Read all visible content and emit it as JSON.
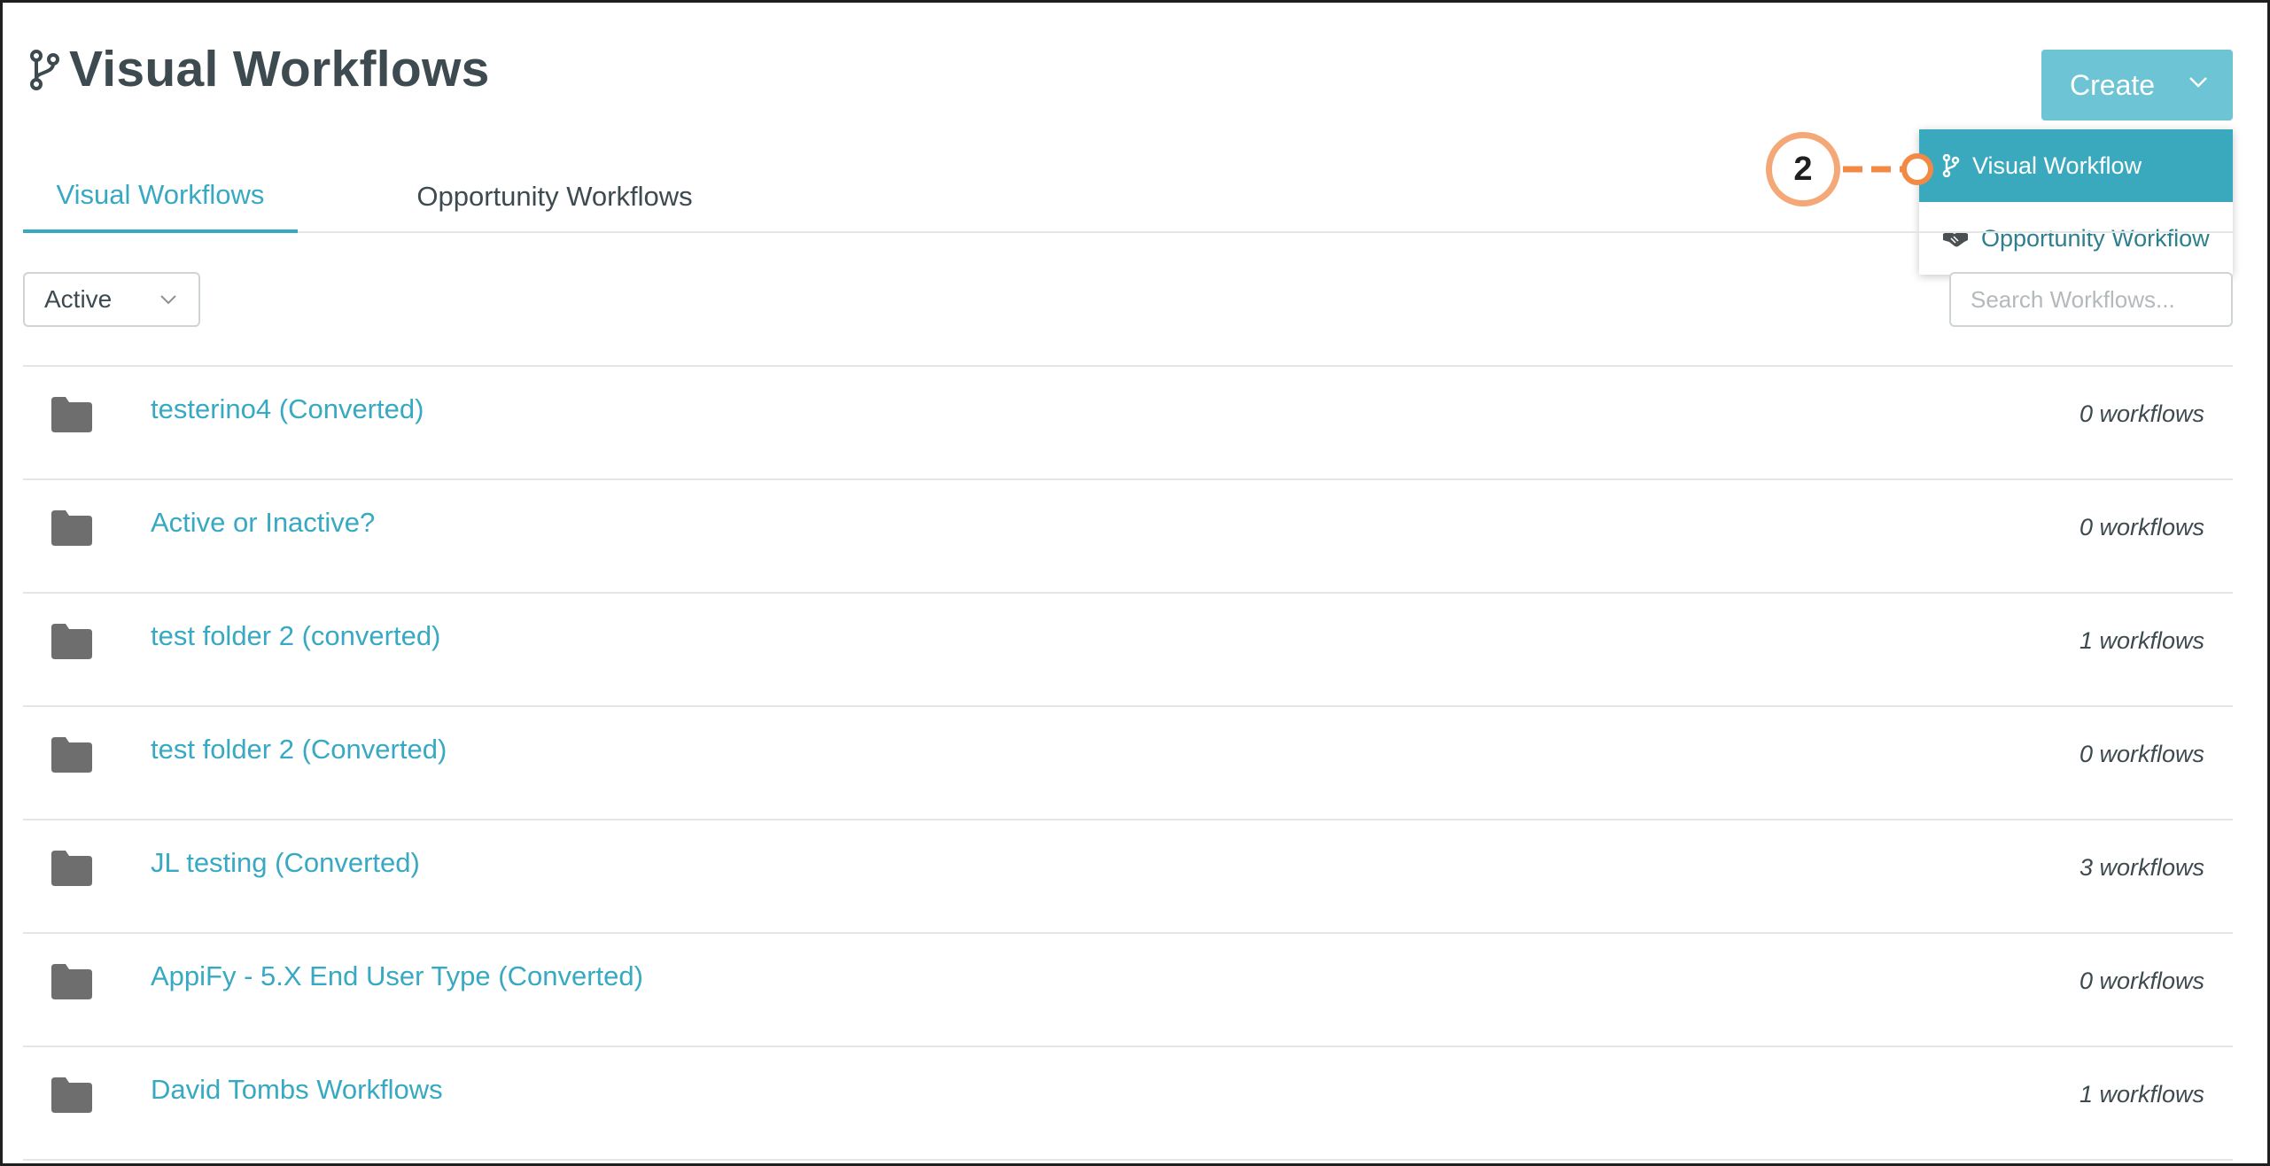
{
  "header": {
    "title": "Visual Workflows",
    "icon": "branch-icon"
  },
  "create_button": {
    "label": "Create"
  },
  "create_menu": {
    "items": [
      {
        "label": "Visual Workflow",
        "icon": "branch-icon",
        "highlighted": true
      },
      {
        "label": "Opportunity Workflow",
        "icon": "handshake-icon",
        "highlighted": false
      }
    ]
  },
  "callout": {
    "number": "2"
  },
  "tabs": [
    {
      "label": "Visual Workflows",
      "active": true
    },
    {
      "label": "Opportunity Workflows",
      "active": false
    }
  ],
  "filter": {
    "selected": "Active"
  },
  "search": {
    "placeholder": "Search Workflows..."
  },
  "folders": [
    {
      "name": "testerino4 (Converted)",
      "count": "0 workflows"
    },
    {
      "name": "Active or Inactive?",
      "count": "0 workflows"
    },
    {
      "name": "test folder 2 (converted)",
      "count": "1 workflows"
    },
    {
      "name": "test folder 2 (Converted)",
      "count": "0 workflows"
    },
    {
      "name": "JL testing (Converted)",
      "count": "3 workflows"
    },
    {
      "name": "AppiFy - 5.X End User Type (Converted)",
      "count": "0 workflows"
    },
    {
      "name": "David Tombs Workflows",
      "count": "1 workflows"
    }
  ],
  "colors": {
    "accent": "#38a9c2",
    "create_button": "#6cc4d4",
    "menu_highlight": "#3aa9be",
    "callout": "#f28a45",
    "folder_icon": "#6e6e6e"
  }
}
